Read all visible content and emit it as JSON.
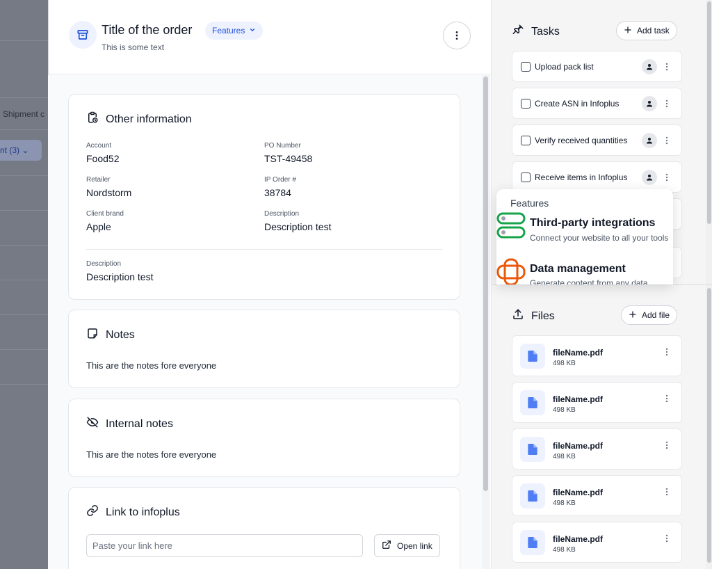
{
  "background": {
    "column_label": "Shipment c",
    "chip_label": "nt (3)"
  },
  "header": {
    "title": "Title of the order",
    "subtitle": "This is some text",
    "features_label": "Features"
  },
  "other_info": {
    "title": "Other information",
    "fields": [
      {
        "label": "Account",
        "value": "Food52"
      },
      {
        "label": "PO Number",
        "value": "TST-49458"
      },
      {
        "label": "Retailer",
        "value": "Nordstorm"
      },
      {
        "label": "IP Order #",
        "value": "38784"
      },
      {
        "label": "Client brand",
        "value": "Apple"
      },
      {
        "label": "Description",
        "value": "Description test"
      }
    ],
    "extra": {
      "label": "Description",
      "value": "Description test"
    }
  },
  "notes": {
    "title": "Notes",
    "text": "This are the notes fore everyone"
  },
  "internal_notes": {
    "title": "Internal notes",
    "text": "This are the notes fore everyone"
  },
  "link": {
    "title": "Link to infoplus",
    "placeholder": "Paste your link here",
    "open_label": "Open link"
  },
  "tasks": {
    "title": "Tasks",
    "add_label": "Add task",
    "items": [
      {
        "label": "Upload pack list"
      },
      {
        "label": "Create ASN in Infoplus"
      },
      {
        "label": "Verify received quantities"
      },
      {
        "label": "Receive items in Infoplus"
      }
    ]
  },
  "features_popover": {
    "heading": "Features",
    "items": [
      {
        "title": "Third-party integrations",
        "description": "Connect your website to all your tools",
        "icon": "toggles-icon",
        "color": "#16a34a"
      },
      {
        "title": "Data management",
        "description": "Generate content from any data",
        "icon": "database-icon",
        "color": "#ea580c"
      }
    ]
  },
  "files": {
    "title": "Files",
    "add_label": "Add file",
    "items": [
      {
        "name": "fileName.pdf",
        "size": "498 KB"
      },
      {
        "name": "fileName.pdf",
        "size": "498 KB"
      },
      {
        "name": "fileName.pdf",
        "size": "498 KB"
      },
      {
        "name": "fileName.pdf",
        "size": "498 KB"
      },
      {
        "name": "fileName.pdf",
        "size": "498 KB"
      }
    ]
  },
  "colors": {
    "accent": "#1d4ed8",
    "file_icon": "#4f7df3"
  }
}
